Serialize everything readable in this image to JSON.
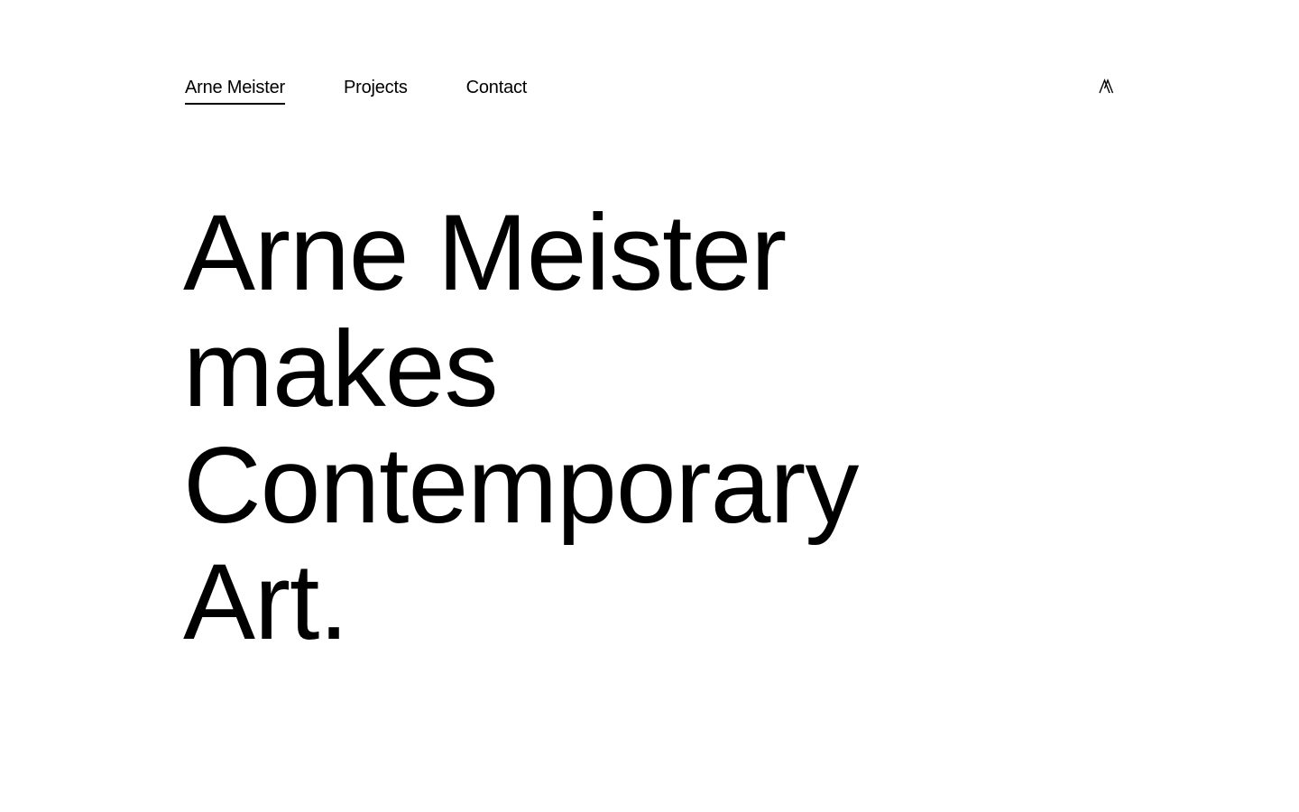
{
  "nav": {
    "items": [
      {
        "label": "Arne Meister",
        "active": true
      },
      {
        "label": "Projects",
        "active": false
      },
      {
        "label": "Contact",
        "active": false
      }
    ],
    "logo_icon": "am-monogram-icon"
  },
  "hero": {
    "lines": [
      "Arne Meister",
      "makes",
      "Contemporary",
      "Art."
    ]
  },
  "colors": {
    "background": "#ffffff",
    "text": "#000000"
  }
}
